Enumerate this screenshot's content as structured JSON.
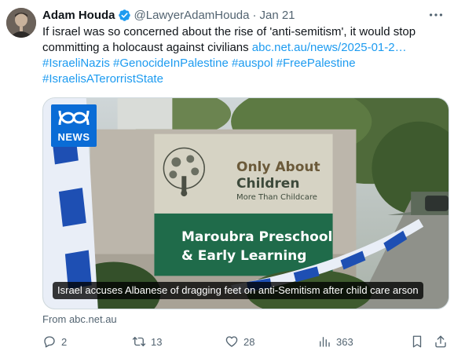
{
  "author": {
    "name": "Adam Houda",
    "handle": "@LawyerAdamHouda",
    "separator": "·",
    "date": "Jan 21"
  },
  "tweet": {
    "line1": "If israel was so concerned about the rise of 'anti-semitism', it would stop",
    "line2_text": "committing a holocaust against civilians ",
    "line2_link": "abc.net.au/news/2025-01-2…",
    "hashtags_line1": "#IsraeliNazis #GenocideInPalestine #auspol #FreePalestine",
    "hashtags_line2": "#IsraelisATerorristState"
  },
  "card": {
    "badge": "NEWS",
    "sign_title_1": "Only About",
    "sign_title_2": "Children",
    "sign_subtitle": "More Than Childcare",
    "sign_lower_1": "Maroubra Preschool",
    "sign_lower_2": "& Early Learning",
    "caption": "Israel accuses Albanese of dragging feet on anti-Semitism after child care arson",
    "from": "From abc.net.au"
  },
  "actions": {
    "replies": "2",
    "reposts": "13",
    "likes": "28",
    "views": "363"
  },
  "icons": {
    "verified": "verified-badge-icon",
    "more": "more-icon",
    "reply": "reply-icon",
    "repost": "repost-icon",
    "like": "heart-icon",
    "views": "views-icon",
    "bookmark": "bookmark-icon",
    "share": "share-icon"
  },
  "colors": {
    "link": "#1d9bf0",
    "verified": "#1d9bf0",
    "muted": "#536471",
    "abc_blue": "#0a6cd6",
    "sign_green": "#1f6b4a"
  }
}
